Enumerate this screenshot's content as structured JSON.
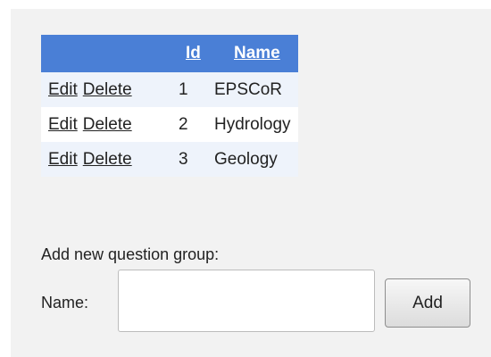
{
  "grid": {
    "headers": {
      "actions": "",
      "id": "Id",
      "name": "Name"
    },
    "rows": [
      {
        "edit": "Edit",
        "delete": "Delete",
        "id": "1",
        "name": "EPSCoR"
      },
      {
        "edit": "Edit",
        "delete": "Delete",
        "id": "2",
        "name": "Hydrology"
      },
      {
        "edit": "Edit",
        "delete": "Delete",
        "id": "3",
        "name": "Geology"
      }
    ]
  },
  "form": {
    "caption": "Add new question group:",
    "name_label": "Name:",
    "name_value": "",
    "add_label": "Add"
  },
  "colors": {
    "header_bg": "#4a7fd6",
    "row_alt_bg": "#eef3fb",
    "panel_bg": "#f2f2f2"
  }
}
